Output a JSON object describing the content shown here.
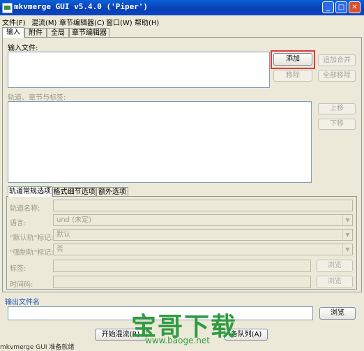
{
  "window": {
    "title": "mkvmerge GUI v5.4.0 ('Piper')",
    "min": "_",
    "max": "□",
    "close": "✕"
  },
  "menu": [
    "文件(F)",
    "混流(M)",
    "章节编辑器(C)",
    "窗口(W)",
    "帮助(H)"
  ],
  "main_tabs": [
    "输入",
    "附件",
    "全局",
    "章节编辑器"
  ],
  "input": {
    "files_label": "输入文件:",
    "add": "添加",
    "append": "追加合并",
    "remove": "移除",
    "remove_all": "全部移除",
    "tracks_label": "轨道、章节与标签:",
    "up": "上移",
    "down": "下移"
  },
  "sub_tabs": [
    "轨道常规选项",
    "格式细节选项",
    "额外选项"
  ],
  "options": {
    "track_name": "轨道名称:",
    "language": "语言:",
    "language_value": "und (未定)",
    "default_flag": "\"默认轨\"标记:",
    "default_value": "默认",
    "forced_flag": "\"强制轨\"标记:",
    "forced_value": "否",
    "tags": "标签:",
    "timecodes": "时间码:",
    "browse": "浏览"
  },
  "output": {
    "label": "输出文件名",
    "browse": "浏览"
  },
  "bottom": {
    "start": "开始混流(R)",
    "queue": "务队列(A)"
  },
  "status": "mkvmerge GUI 准备就绪",
  "watermark": {
    "text": "宝哥下载",
    "url": "www.baoge.net"
  },
  "colors": {
    "titlebar": "#0a5fd8",
    "highlight": "#e03a3a",
    "watermark": "#2f9c42"
  }
}
